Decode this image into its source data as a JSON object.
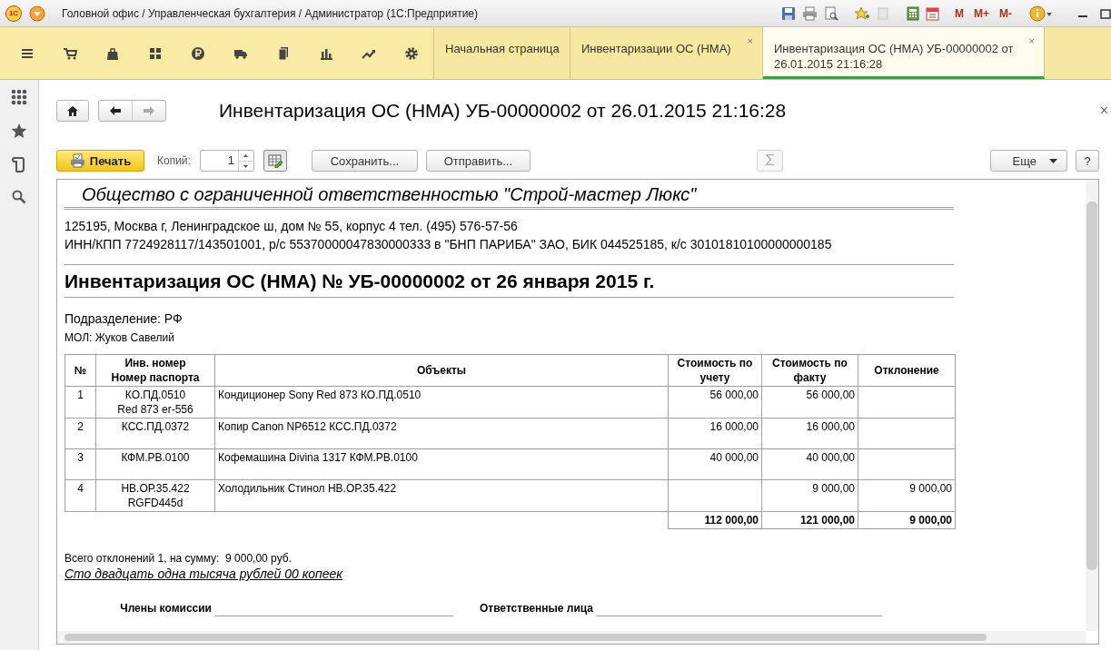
{
  "window": {
    "logo": "1С",
    "title": "Головной офис / Управленческая бухгалтерия / Администратор (1С:Предприятие)",
    "memory_buttons": [
      "M",
      "M+",
      "M-"
    ]
  },
  "tabs": [
    {
      "label": "Начальная страница",
      "selected": false
    },
    {
      "label": "Инвентаризации ОС (НМА)",
      "selected": false,
      "close": "×"
    },
    {
      "label": "Инвентаризация ОС (НМА) УБ-00000002 от 26.01.2015 21:16:28",
      "selected": true,
      "close": "×"
    }
  ],
  "form": {
    "title": "Инвентаризация ОС (НМА) УБ-00000002 от 26.01.2015 21:16:28",
    "close": "×",
    "print_button": "Печать",
    "copies_label": "Копий:",
    "copies_value": "1",
    "save_button": "Сохранить...",
    "send_button": "Отправить...",
    "sum_button": {
      "label": "Σ",
      "disabled": true
    },
    "more_button": "Еще",
    "help_button": "?"
  },
  "document": {
    "company": "Общество с ограниченной ответственностью \"Строй-мастер Люкс\"",
    "address_lines": [
      "125195, Москва г, Ленинградское ш, дом № 55, корпус 4 тел. (495) 576-57-56",
      "ИНН/КПП 7724928117/143501001, р/с 55370000047830000333 в \"БНП ПАРИБА\" ЗАО, БИК 044525185, к/с 30101810100000000185"
    ],
    "heading": "Инвентаризация ОС (НМА) № УБ-00000002 от 26 января 2015 г.",
    "department": "Подразделение: РФ",
    "responsible_person": "МОЛ: Жуков Савелий",
    "table": {
      "columns": [
        "№",
        "Инв. номер\nНомер паспорта",
        "Объекты",
        "Стоимость по учету",
        "Стоимость по факту",
        "Отклонение"
      ],
      "rows": [
        {
          "number": "1",
          "inventory_number": "КО.ПД.0510",
          "passport_number": "Red 873 er-556",
          "object": "Кондиционер Sony Red 873 КО.ПД.0510",
          "book_value": "56 000,00",
          "actual_value": "56 000,00"
        },
        {
          "number": "2",
          "inventory_number": "КСС.ПД.0372",
          "object": "Копир Canon NP6512 КСС.ПД.0372",
          "book_value": "16 000,00",
          "actual_value": "16 000,00"
        },
        {
          "number": "3",
          "inventory_number": "КФМ.РВ.0100",
          "object": "Кофемашина Divina 1317 КФМ.РВ.0100",
          "book_value": "40 000,00",
          "actual_value": "40 000,00"
        },
        {
          "number": "4",
          "inventory_number": "НВ.ОР.35.422",
          "passport_number": "RGFD445d",
          "object": "Холодильник Стинол НВ.ОР.35.422",
          "actual_value": "9 000,00",
          "deviation": "9 000,00"
        }
      ],
      "totals": {
        "book_value": "112 000,00",
        "actual_value": "121 000,00",
        "deviation": "9 000,00"
      }
    },
    "summary": "Всего отклонений 1, на сумму:  9 000,00 руб.",
    "amount_in_words": "Сто двадцать одна тысяча рублей 00 копеек",
    "signatures": [
      {
        "label": "Члены комиссии"
      },
      {
        "label": "Ответственные лица"
      }
    ]
  }
}
